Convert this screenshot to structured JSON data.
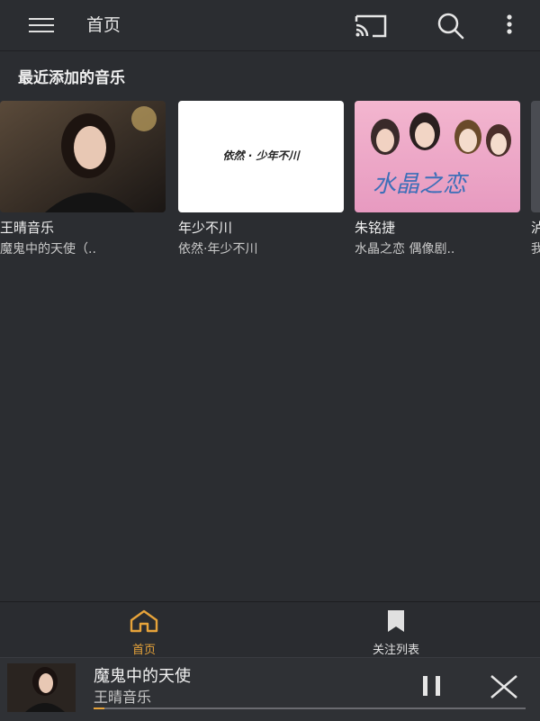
{
  "header": {
    "title": "首页",
    "icons": [
      "menu-icon",
      "cast-icon",
      "search-icon",
      "more-vertical-icon"
    ]
  },
  "section": {
    "title": "最近添加的音乐"
  },
  "albums": [
    {
      "title": "王晴音乐",
      "subtitle": "魔鬼中的天使（..",
      "cover": "portrait-photo"
    },
    {
      "title": "年少不川",
      "subtitle": "依然·年少不川",
      "cover": "white-cover-with-text",
      "cover_text": "依然 · 少年不川"
    },
    {
      "title": "朱铭捷",
      "subtitle": "水晶之恋 偶像剧..",
      "cover": "pink-drama-poster",
      "cover_text": "水晶之恋"
    },
    {
      "title": "泸",
      "subtitle": "我",
      "cover": "partial"
    }
  ],
  "bottom_nav": [
    {
      "label": "首页",
      "icon": "home-icon",
      "active": true
    },
    {
      "label": "关注列表",
      "icon": "bookmark-icon",
      "active": false
    }
  ],
  "player": {
    "song": "魔鬼中的天使",
    "artist": "王晴音乐",
    "progress": 0.025,
    "icons": [
      "pause-icon",
      "close-icon"
    ]
  },
  "colors": {
    "background": "#2b2d31",
    "accent": "#e6a33a",
    "text": "#e8e8e8",
    "secondary_text": "#c9c9c9"
  }
}
